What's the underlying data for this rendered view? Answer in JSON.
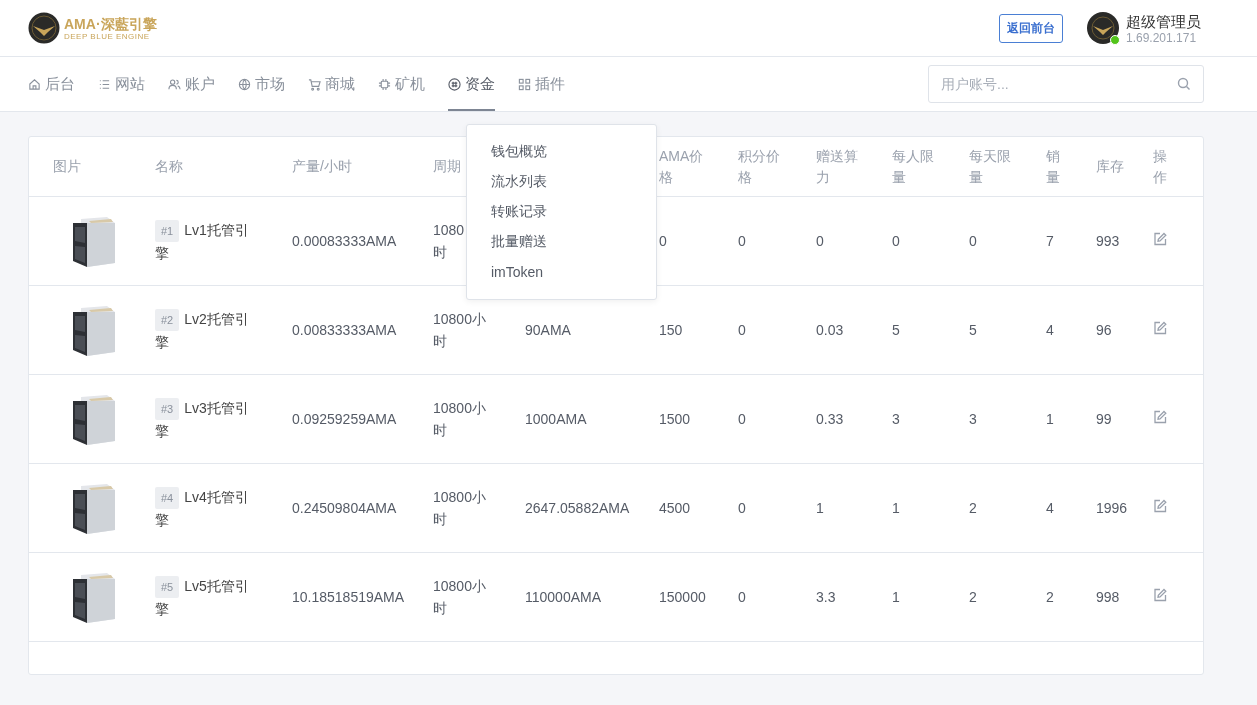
{
  "header": {
    "logo_title": "AMA·深藍引擎",
    "logo_subtitle": "DEEP BLUE ENGINE",
    "front_button": "返回前台",
    "user": {
      "name": "超级管理员",
      "ip": "1.69.201.171",
      "online": true
    }
  },
  "nav": [
    {
      "label": "后台",
      "selected": false
    },
    {
      "label": "网站",
      "selected": false
    },
    {
      "label": "账户",
      "selected": false
    },
    {
      "label": "市场",
      "selected": false
    },
    {
      "label": "商城",
      "selected": false
    },
    {
      "label": "矿机",
      "selected": false
    },
    {
      "label": "资金",
      "selected": true
    },
    {
      "label": "插件",
      "selected": false
    }
  ],
  "search": {
    "placeholder": "用户账号..."
  },
  "dropdown": [
    "钱包概览",
    "流水列表",
    "转账记录",
    "批量赠送",
    "imToken"
  ],
  "table": {
    "columns": [
      {
        "lines": [
          "图片"
        ]
      },
      {
        "lines": [
          "名称"
        ]
      },
      {
        "lines": [
          "产量/小时"
        ]
      },
      {
        "lines": [
          "周期"
        ]
      },
      {
        "lines": [
          "AMA价",
          "格"
        ]
      },
      {
        "lines": [
          "积分价",
          "格"
        ]
      },
      {
        "lines": [
          "赠送算",
          "力"
        ]
      },
      {
        "lines": [
          "每人限",
          "量"
        ]
      },
      {
        "lines": [
          "每天限",
          "量"
        ]
      },
      {
        "lines": [
          "销",
          "量"
        ]
      },
      {
        "lines": [
          "库存"
        ]
      },
      {
        "lines": [
          "操",
          "作"
        ]
      }
    ],
    "rows": [
      {
        "tag": "#1",
        "name": [
          "Lv1托管引",
          "擎"
        ],
        "output": "0.00083333AMA",
        "cycle": [
          "1080",
          "时"
        ],
        "ama": "0",
        "points": "0",
        "gift": "0",
        "per_person": "0",
        "per_day": "0",
        "sold": "7",
        "stock": "993"
      },
      {
        "tag": "#2",
        "name": [
          "Lv2托管引",
          "擎"
        ],
        "output": "0.00833333AMA",
        "cycle": [
          "10800小",
          "时"
        ],
        "price": "90AMA",
        "ama": "150",
        "points": "0",
        "gift": "0.03",
        "per_person": "5",
        "per_day": "5",
        "sold": "4",
        "stock": "96"
      },
      {
        "tag": "#3",
        "name": [
          "Lv3托管引",
          "擎"
        ],
        "output": "0.09259259AMA",
        "cycle": [
          "10800小",
          "时"
        ],
        "price": "1000AMA",
        "ama": "1500",
        "points": "0",
        "gift": "0.33",
        "per_person": "3",
        "per_day": "3",
        "sold": "1",
        "stock": "99"
      },
      {
        "tag": "#4",
        "name": [
          "Lv4托管引",
          "擎"
        ],
        "output": "0.24509804AMA",
        "cycle": [
          "10800小",
          "时"
        ],
        "price": "2647.05882AMA",
        "ama": "4500",
        "points": "0",
        "gift": "1",
        "per_person": "1",
        "per_day": "2",
        "sold": "4",
        "stock": "1996"
      },
      {
        "tag": "#5",
        "name": [
          "Lv5托管引",
          "擎"
        ],
        "output": "10.18518519AMA",
        "cycle": [
          "10800小",
          "时"
        ],
        "price": "110000AMA",
        "ama": "150000",
        "points": "0",
        "gift": "3.3",
        "per_person": "1",
        "per_day": "2",
        "sold": "2",
        "stock": "998"
      }
    ]
  }
}
